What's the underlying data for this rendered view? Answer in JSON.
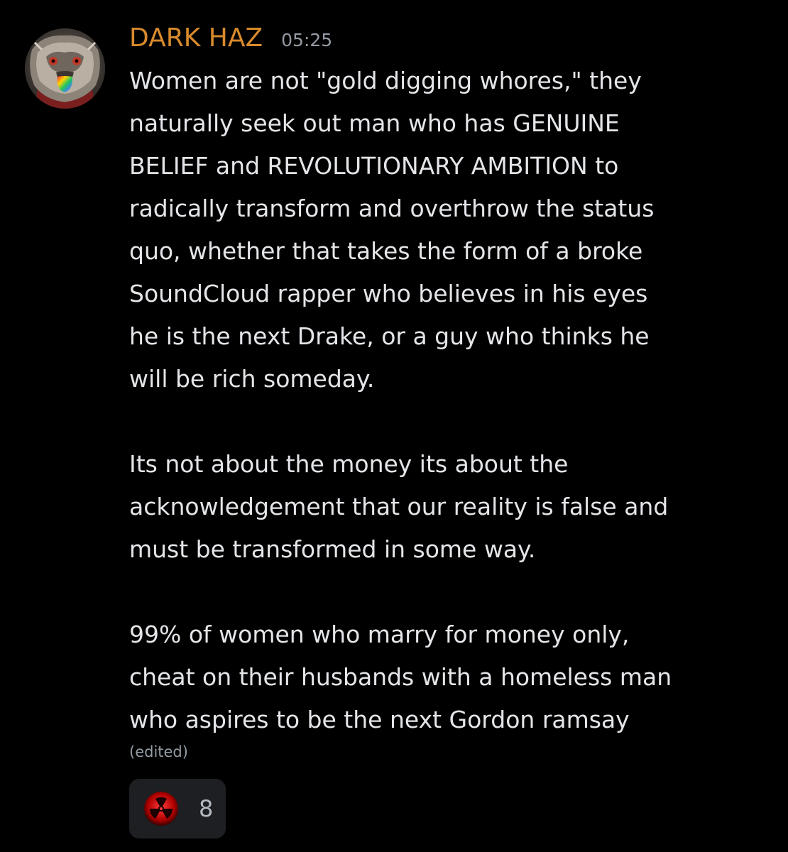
{
  "message": {
    "author": "DARK HAZ",
    "timestamp": "05:25",
    "author_color": "#d88a2c",
    "avatar_icon": "demon-mask-avatar",
    "paragraphs": [
      [
        "Women are not \"gold digging whores,\" they",
        "naturally seek out man who has GENUINE",
        "BELIEF and REVOLUTIONARY AMBITION to",
        "radically transform and overthrow the status",
        "quo, whether that takes the form of a broke",
        "SoundCloud rapper who believes in his eyes",
        "he is the next Drake, or a guy who thinks he",
        "will be rich someday."
      ],
      [
        "Its not about the money its about the",
        "acknowledgement that our reality is false and",
        "must be transformed in some way."
      ],
      [
        "99% of women who marry for money only,",
        "cheat on their husbands with a homeless man",
        "who aspires to be the next Gordon ramsay"
      ]
    ],
    "edited_label": "(edited)",
    "reaction": {
      "emoji": "radioactive-red-icon",
      "count": "8"
    }
  }
}
